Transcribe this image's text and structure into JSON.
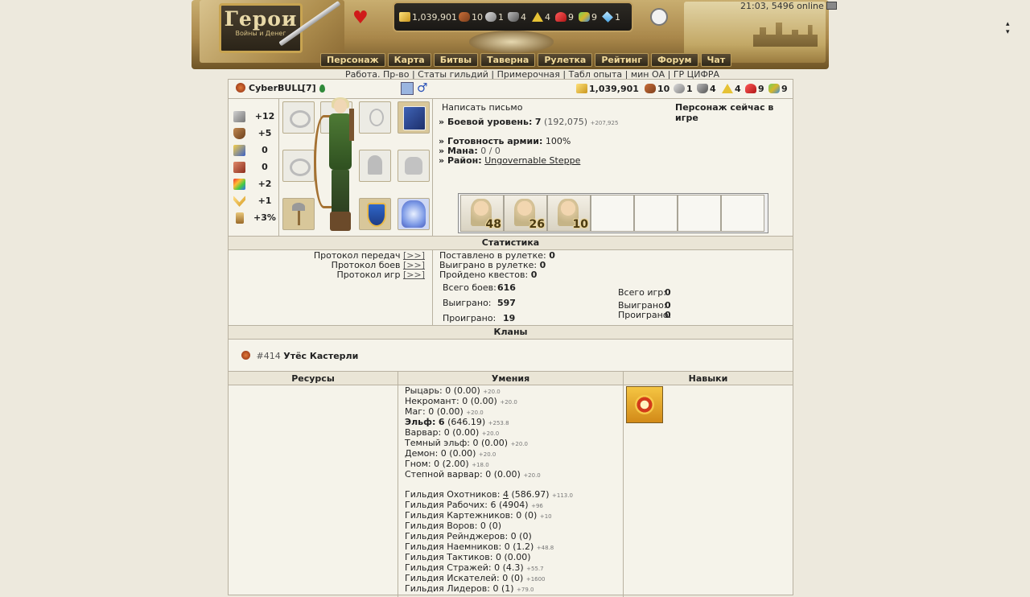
{
  "header": {
    "logo_main": "Герои",
    "logo_sub": "Войны и Денег",
    "status": "21:03, 5496 online",
    "resources": [
      {
        "icon": "gold-icon",
        "value": "1,039,901"
      },
      {
        "icon": "wood-icon",
        "value": "10"
      },
      {
        "icon": "ore-icon",
        "value": "1"
      },
      {
        "icon": "mercury-icon",
        "value": "4"
      },
      {
        "icon": "sulfur-icon",
        "value": "4"
      },
      {
        "icon": "crystal-icon",
        "value": "9"
      },
      {
        "icon": "gem-icon",
        "value": "9"
      },
      {
        "icon": "diamond-icon",
        "value": "1"
      }
    ],
    "nav": [
      "Персонаж",
      "Карта",
      "Битвы",
      "Таверна",
      "Рулетка",
      "Рейтинг",
      "Форум",
      "Чат"
    ],
    "sublinks": [
      "Работа. Пр-во",
      "Статы гильдий",
      "Примерочная",
      "Табл опыта",
      "мин ОА",
      "ГР ЦИФРА"
    ]
  },
  "player": {
    "name": "CyberBULL",
    "level": "[7]",
    "resources": [
      {
        "icon": "gold-icon",
        "value": "1,039,901"
      },
      {
        "icon": "wood-icon",
        "value": "10"
      },
      {
        "icon": "ore-icon",
        "value": "1"
      },
      {
        "icon": "mercury-icon",
        "value": "4"
      },
      {
        "icon": "sulfur-icon",
        "value": "4"
      },
      {
        "icon": "crystal-icon",
        "value": "9"
      },
      {
        "icon": "gem-icon",
        "value": "9"
      }
    ],
    "stats": [
      {
        "icon": "attack-icon",
        "value": "+12",
        "color": "#8a8a8a"
      },
      {
        "icon": "defense-icon",
        "value": "+5",
        "color": "#8c5a2e"
      },
      {
        "icon": "spellpower-icon",
        "value": "0",
        "color": "#d2a02a"
      },
      {
        "icon": "knowledge-icon",
        "value": "0",
        "color": "#b5503a"
      },
      {
        "icon": "luck-icon",
        "value": "+2",
        "color": "#e3a530"
      },
      {
        "icon": "morale-icon",
        "value": "+1",
        "color": "#e0b040"
      },
      {
        "icon": "initiative-icon",
        "value": "+3%",
        "color": "#c58a30"
      }
    ],
    "write_letter": "Написать письмо",
    "online_status": "Персонаж сейчас в игре",
    "combat_level_label": "Боевой уровень:",
    "combat_level": "7",
    "combat_exp": "(192,075)",
    "combat_exp_delta": "+207,925",
    "army_label": "Готовность армии:",
    "army_value": "100%",
    "mana_label": "Мана:",
    "mana_value": "0 / 0",
    "district_label": "Район:",
    "district_value": "Ungovernable Steppe",
    "troops": [
      "48",
      "26",
      "10",
      "",
      "",
      "",
      ""
    ]
  },
  "statistics": {
    "title": "Статистика",
    "protocols": [
      {
        "label": "Протокол передач",
        "link": "[>>]"
      },
      {
        "label": "Протокол боев",
        "link": "[>>]"
      },
      {
        "label": "Протокол игр",
        "link": "[>>]"
      }
    ],
    "roulette_bet_label": "Поставлено в рулетке:",
    "roulette_bet": "0",
    "roulette_won_label": "Выиграно в рулетке:",
    "roulette_won": "0",
    "quests_label": "Пройдено квестов:",
    "quests": "0",
    "battles_total_label": "Всего боев:",
    "battles_total": "616",
    "battles_won_label": "Выиграно:",
    "battles_won": "597",
    "battles_lost_label": "Проиграно:",
    "battles_lost": "19",
    "games_total_label": "Всего игр:",
    "games_total": "0",
    "games_won_label": "Выиграно:",
    "games_won": "0",
    "games_lost_label": "Проиграно:",
    "games_lost": "0"
  },
  "clans": {
    "title": "Кланы",
    "clan_id": "#414",
    "clan_name": "Утёс Кастерли"
  },
  "bottom": {
    "resources_title": "Ресурсы",
    "skills_title": "Умения",
    "abilities_title": "Навыки",
    "factions": [
      {
        "name": "Рыцарь:",
        "level": "0",
        "score": "(0.00)",
        "delta": "+20.0",
        "bold": false
      },
      {
        "name": "Некромант:",
        "level": "0",
        "score": "(0.00)",
        "delta": "+20.0",
        "bold": false
      },
      {
        "name": "Маг:",
        "level": "0",
        "score": "(0.00)",
        "delta": "+20.0",
        "bold": false
      },
      {
        "name": "Эльф:",
        "level": "6",
        "score": "(646.19)",
        "delta": "+253.8",
        "bold": true
      },
      {
        "name": "Варвар:",
        "level": "0",
        "score": "(0.00)",
        "delta": "+20.0",
        "bold": false
      },
      {
        "name": "Темный эльф:",
        "level": "0",
        "score": "(0.00)",
        "delta": "+20.0",
        "bold": false
      },
      {
        "name": "Демон:",
        "level": "0",
        "score": "(0.00)",
        "delta": "+20.0",
        "bold": false
      },
      {
        "name": "Гном:",
        "level": "0",
        "score": "(2.00)",
        "delta": "+18.0",
        "bold": false
      },
      {
        "name": "Степной варвар:",
        "level": "0",
        "score": "(0.00)",
        "delta": "+20.0",
        "bold": false
      }
    ],
    "guilds": [
      {
        "name": "Гильдия Охотников:",
        "level": "4",
        "score": "(586.97)",
        "delta": "+113.0"
      },
      {
        "name": "Гильдия Рабочих:",
        "level": "6",
        "score": "(4904)",
        "delta": "+96"
      },
      {
        "name": "Гильдия Картежников:",
        "level": "0",
        "score": "(0)",
        "delta": "+10"
      },
      {
        "name": "Гильдия Воров:",
        "level": "0",
        "score": "(0)",
        "delta": ""
      },
      {
        "name": "Гильдия Рейнджеров:",
        "level": "0",
        "score": "(0)",
        "delta": ""
      },
      {
        "name": "Гильдия Наемников:",
        "level": "0",
        "score": "(1.2)",
        "delta": "+48.8"
      },
      {
        "name": "Гильдия Тактиков:",
        "level": "0",
        "score": "(0.00)",
        "delta": ""
      },
      {
        "name": "Гильдия Стражей:",
        "level": "0",
        "score": "(4.3)",
        "delta": "+55.7"
      },
      {
        "name": "Гильдия Искателей:",
        "level": "0",
        "score": "(0)",
        "delta": "+1600"
      },
      {
        "name": "Гильдия Лидеров:",
        "level": "0",
        "score": "(1)",
        "delta": "+79.0"
      }
    ]
  }
}
